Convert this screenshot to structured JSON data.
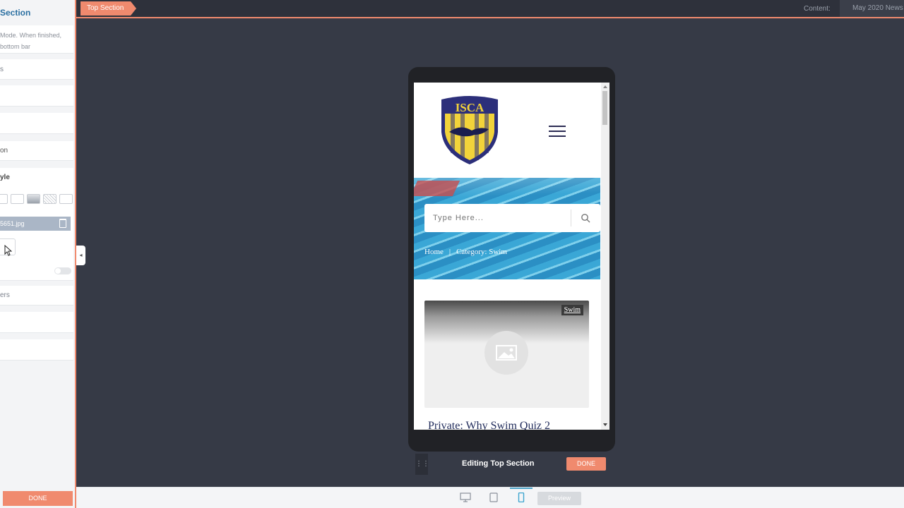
{
  "topbar": {
    "section_tab": "Top Section",
    "content_label": "Content:",
    "content_value": "May 2020 News"
  },
  "panel": {
    "title": "Section",
    "help_line1": "Mode. When finished,",
    "help_line2": "bottom bar",
    "row1": "s",
    "row2": "on",
    "row3": "yle",
    "file_name": "5651.jpg",
    "row4": "ers",
    "done": "DONE"
  },
  "site": {
    "search_placeholder": "Type Here...",
    "breadcrumb_home": "Home",
    "breadcrumb_sep": "|",
    "breadcrumb_current": "Category: Swim",
    "card_tag": "Swim",
    "post_title": "Private: Why Swim Quiz 2",
    "logo_text": "ISCA"
  },
  "editbar": {
    "label": "Editing Top Section",
    "done": "DONE"
  },
  "bottombar": {
    "preview": "Preview"
  },
  "colors": {
    "accent": "#f08a6e",
    "canvas": "#363a46",
    "panel_title": "#2a6fa1",
    "logo_navy": "#2c2f7a",
    "logo_yellow": "#f2d33a"
  }
}
